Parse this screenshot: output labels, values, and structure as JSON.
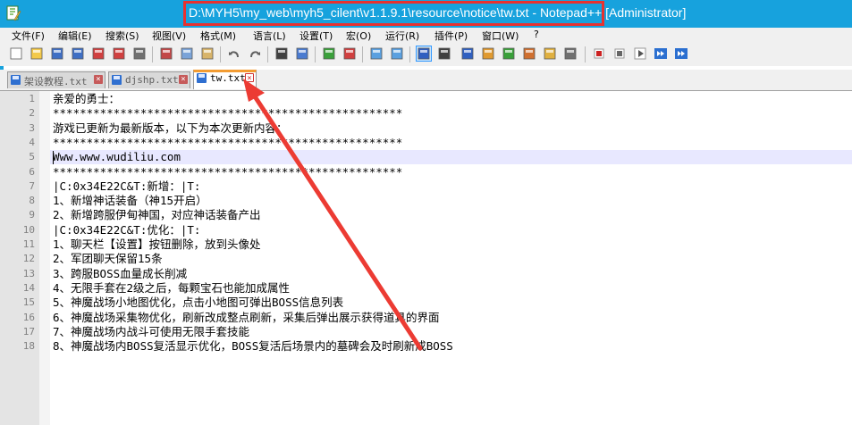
{
  "window": {
    "title_path": "D:\\MYH5\\my_web\\myh5_cilent\\v1.1.9.1\\resource\\notice\\tw.txt",
    "title_suffix": " - Notepad++ [Administrator]",
    "accent_color": "#17a2dd",
    "highlight_color": "#e8312f"
  },
  "menu": [
    {
      "label": "文件(F)"
    },
    {
      "label": "编辑(E)"
    },
    {
      "label": "搜索(S)"
    },
    {
      "label": "视图(V)"
    },
    {
      "label": "格式(M)"
    },
    {
      "label": "语言(L)"
    },
    {
      "label": "设置(T)"
    },
    {
      "label": "宏(O)"
    },
    {
      "label": "运行(R)"
    },
    {
      "label": "插件(P)"
    },
    {
      "label": "窗口(W)"
    },
    {
      "label": "?"
    }
  ],
  "toolbar": {
    "icons": [
      "new-file-icon",
      "open-file-icon",
      "save-icon",
      "save-all-icon",
      "close-icon",
      "close-all-icon",
      "print-icon",
      "cut-icon",
      "copy-icon",
      "paste-icon",
      "undo-icon",
      "redo-icon",
      "find-icon",
      "replace-icon",
      "zoom-in-icon",
      "zoom-out-icon",
      "sync-vertical-icon",
      "sync-horizontal-icon",
      "word-wrap-icon",
      "show-all-chars-icon",
      "indent-guide-icon",
      "udl-icon",
      "doc-map-icon",
      "function-list-icon",
      "folder-workspace-icon",
      "monitoring-icon",
      "record-macro-icon",
      "stop-record-icon",
      "play-macro-icon",
      "run-multiple-icon",
      "save-macro-icon"
    ]
  },
  "tabs": [
    {
      "label": "架设教程.txt",
      "active": false
    },
    {
      "label": "djshp.txt",
      "active": false
    },
    {
      "label": "tw.txt",
      "active": true
    }
  ],
  "editor": {
    "current_line": 5,
    "lines": [
      {
        "no": "1",
        "text": "亲爱的勇士："
      },
      {
        "no": "2",
        "text": "****************************************************"
      },
      {
        "no": "3",
        "text": "游戏已更新为最新版本，以下为本次更新内容："
      },
      {
        "no": "4",
        "text": "****************************************************"
      },
      {
        "no": "5",
        "text": "Www.www.wudiliu.com"
      },
      {
        "no": "6",
        "text": "****************************************************"
      },
      {
        "no": "7",
        "text": "|C:0x34E22C&T:新增：|T:"
      },
      {
        "no": "8",
        "text": "1、新增神话装备（神15开启）"
      },
      {
        "no": "9",
        "text": "2、新增跨服伊甸神国，对应神话装备产出"
      },
      {
        "no": "10",
        "text": "|C:0x34E22C&T:优化：|T:"
      },
      {
        "no": "11",
        "text": "1、聊天栏【设置】按钮删除，放到头像处"
      },
      {
        "no": "12",
        "text": "2、军团聊天保留15条"
      },
      {
        "no": "13",
        "text": "3、跨服BOSS血量成长削减"
      },
      {
        "no": "14",
        "text": "4、无限手套在2级之后，每颗宝石也能加成属性"
      },
      {
        "no": "15",
        "text": "5、神魔战场小地图优化，点击小地图可弹出BOSS信息列表"
      },
      {
        "no": "16",
        "text": "6、神魔战场采集物优化，刷新改成整点刷新，采集后弹出展示获得道具的界面"
      },
      {
        "no": "17",
        "text": "7、神魔战场内战斗可使用无限手套技能"
      },
      {
        "no": "18",
        "text": "8、神魔战场内BOSS复活显示优化，BOSS复活后场景内的墓碑会及时刷新成BOSS"
      }
    ]
  }
}
